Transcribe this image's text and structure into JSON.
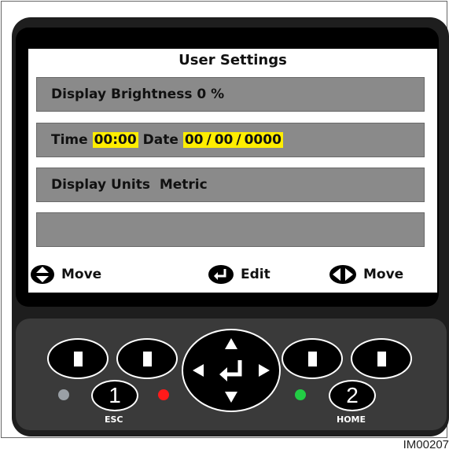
{
  "screen": {
    "title": "User Settings",
    "brightness_row": "Display Brightness 0 %",
    "time_label": "Time",
    "time_value": "00:00",
    "date_label": "Date",
    "date_day": "00",
    "date_month": "00",
    "date_year": "0000",
    "date_separator": "/",
    "units_row": "Display Units  Metric",
    "empty_row": ""
  },
  "hints": {
    "left_move": "Move",
    "edit": "Edit",
    "right_move": "Move",
    "left_move_icon": "up-down-arrows-icon",
    "edit_icon": "enter-icon",
    "right_move_icon": "left-right-arrows-icon"
  },
  "keypad": {
    "esc_number": "1",
    "esc_label": "ESC",
    "home_number": "2",
    "home_label": "HOME",
    "led_colors": {
      "grey": "#9aa0a6",
      "red": "#ff1a1a",
      "green": "#22cc44"
    }
  },
  "figure_id": "IM00207"
}
